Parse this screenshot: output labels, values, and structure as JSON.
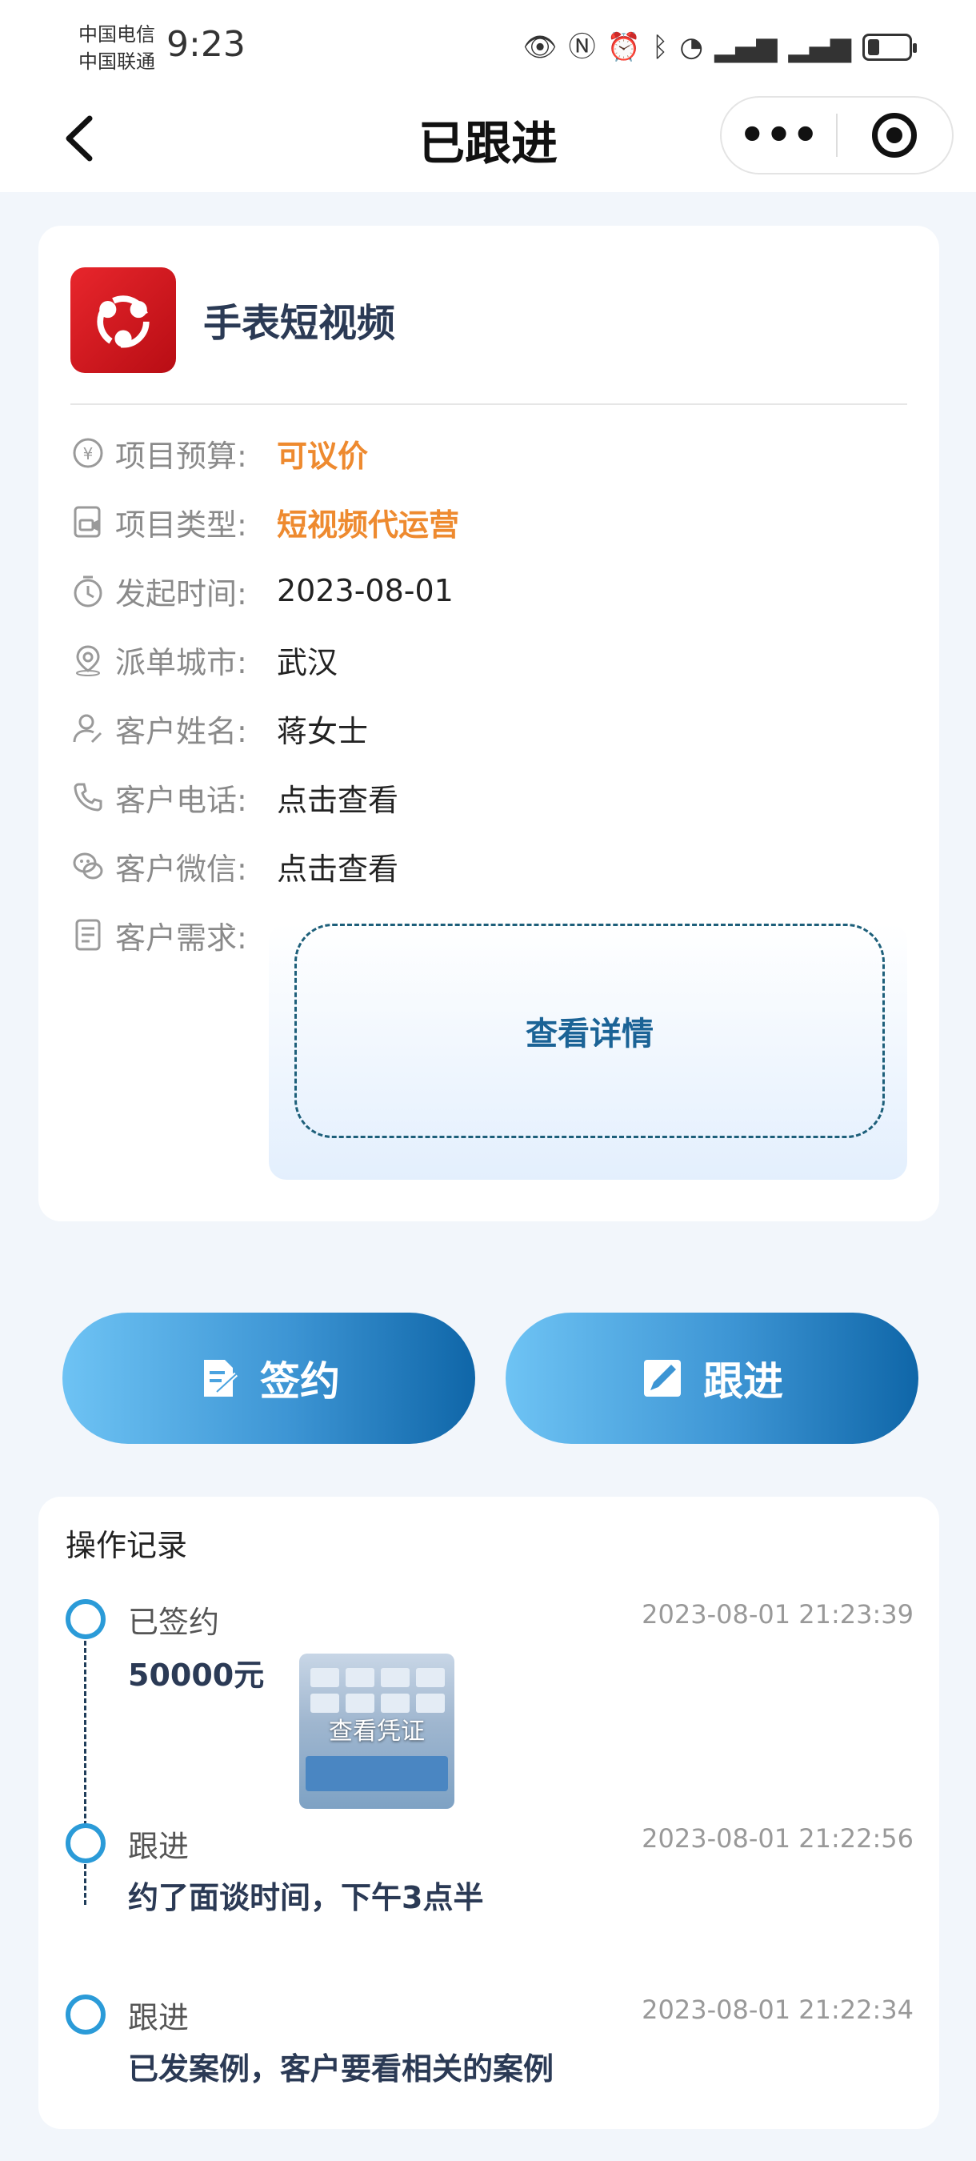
{
  "status_bar": {
    "carrier_1": "中国电信",
    "carrier_2": "中国联通",
    "time": "9:23"
  },
  "nav": {
    "title": "已跟进"
  },
  "project": {
    "name": "手表短视频",
    "fields": [
      {
        "label": "项目预算:",
        "value": "可议价",
        "icon": "yen-icon"
      },
      {
        "label": "项目类型:",
        "value": "短视频代运营",
        "icon": "video-icon"
      },
      {
        "label": "发起时间:",
        "value": "2023-08-01",
        "icon": "timer-icon"
      },
      {
        "label": "派单城市:",
        "value": "武汉",
        "icon": "location-icon"
      },
      {
        "label": "客户姓名:",
        "value": "蒋女士",
        "icon": "user-icon"
      },
      {
        "label": "客户电话:",
        "value": "点击查看",
        "icon": "phone-icon"
      },
      {
        "label": "客户微信:",
        "value": "点击查看",
        "icon": "wechat-icon"
      },
      {
        "label": "客户需求:",
        "value": "",
        "icon": "document-icon"
      }
    ],
    "detail_link": "查看详情"
  },
  "actions": {
    "sign_label": "签约",
    "follow_label": "跟进"
  },
  "records": {
    "title": "操作记录",
    "items": [
      {
        "type": "已签约",
        "time": "2023-08-01 21:23:39",
        "body": "50000元",
        "voucher_label": "查看凭证"
      },
      {
        "type": "跟进",
        "time": "2023-08-01 21:22:56",
        "body": "约了面谈时间，下午3点半"
      },
      {
        "type": "跟进",
        "time": "2023-08-01 21:22:34",
        "body": "已发案例，客户要看相关的案例"
      }
    ]
  },
  "colors": {
    "accent_orange": "#ee8a2f",
    "accent_blue": "#2b9bd8",
    "logo_red": "#d81a22"
  }
}
